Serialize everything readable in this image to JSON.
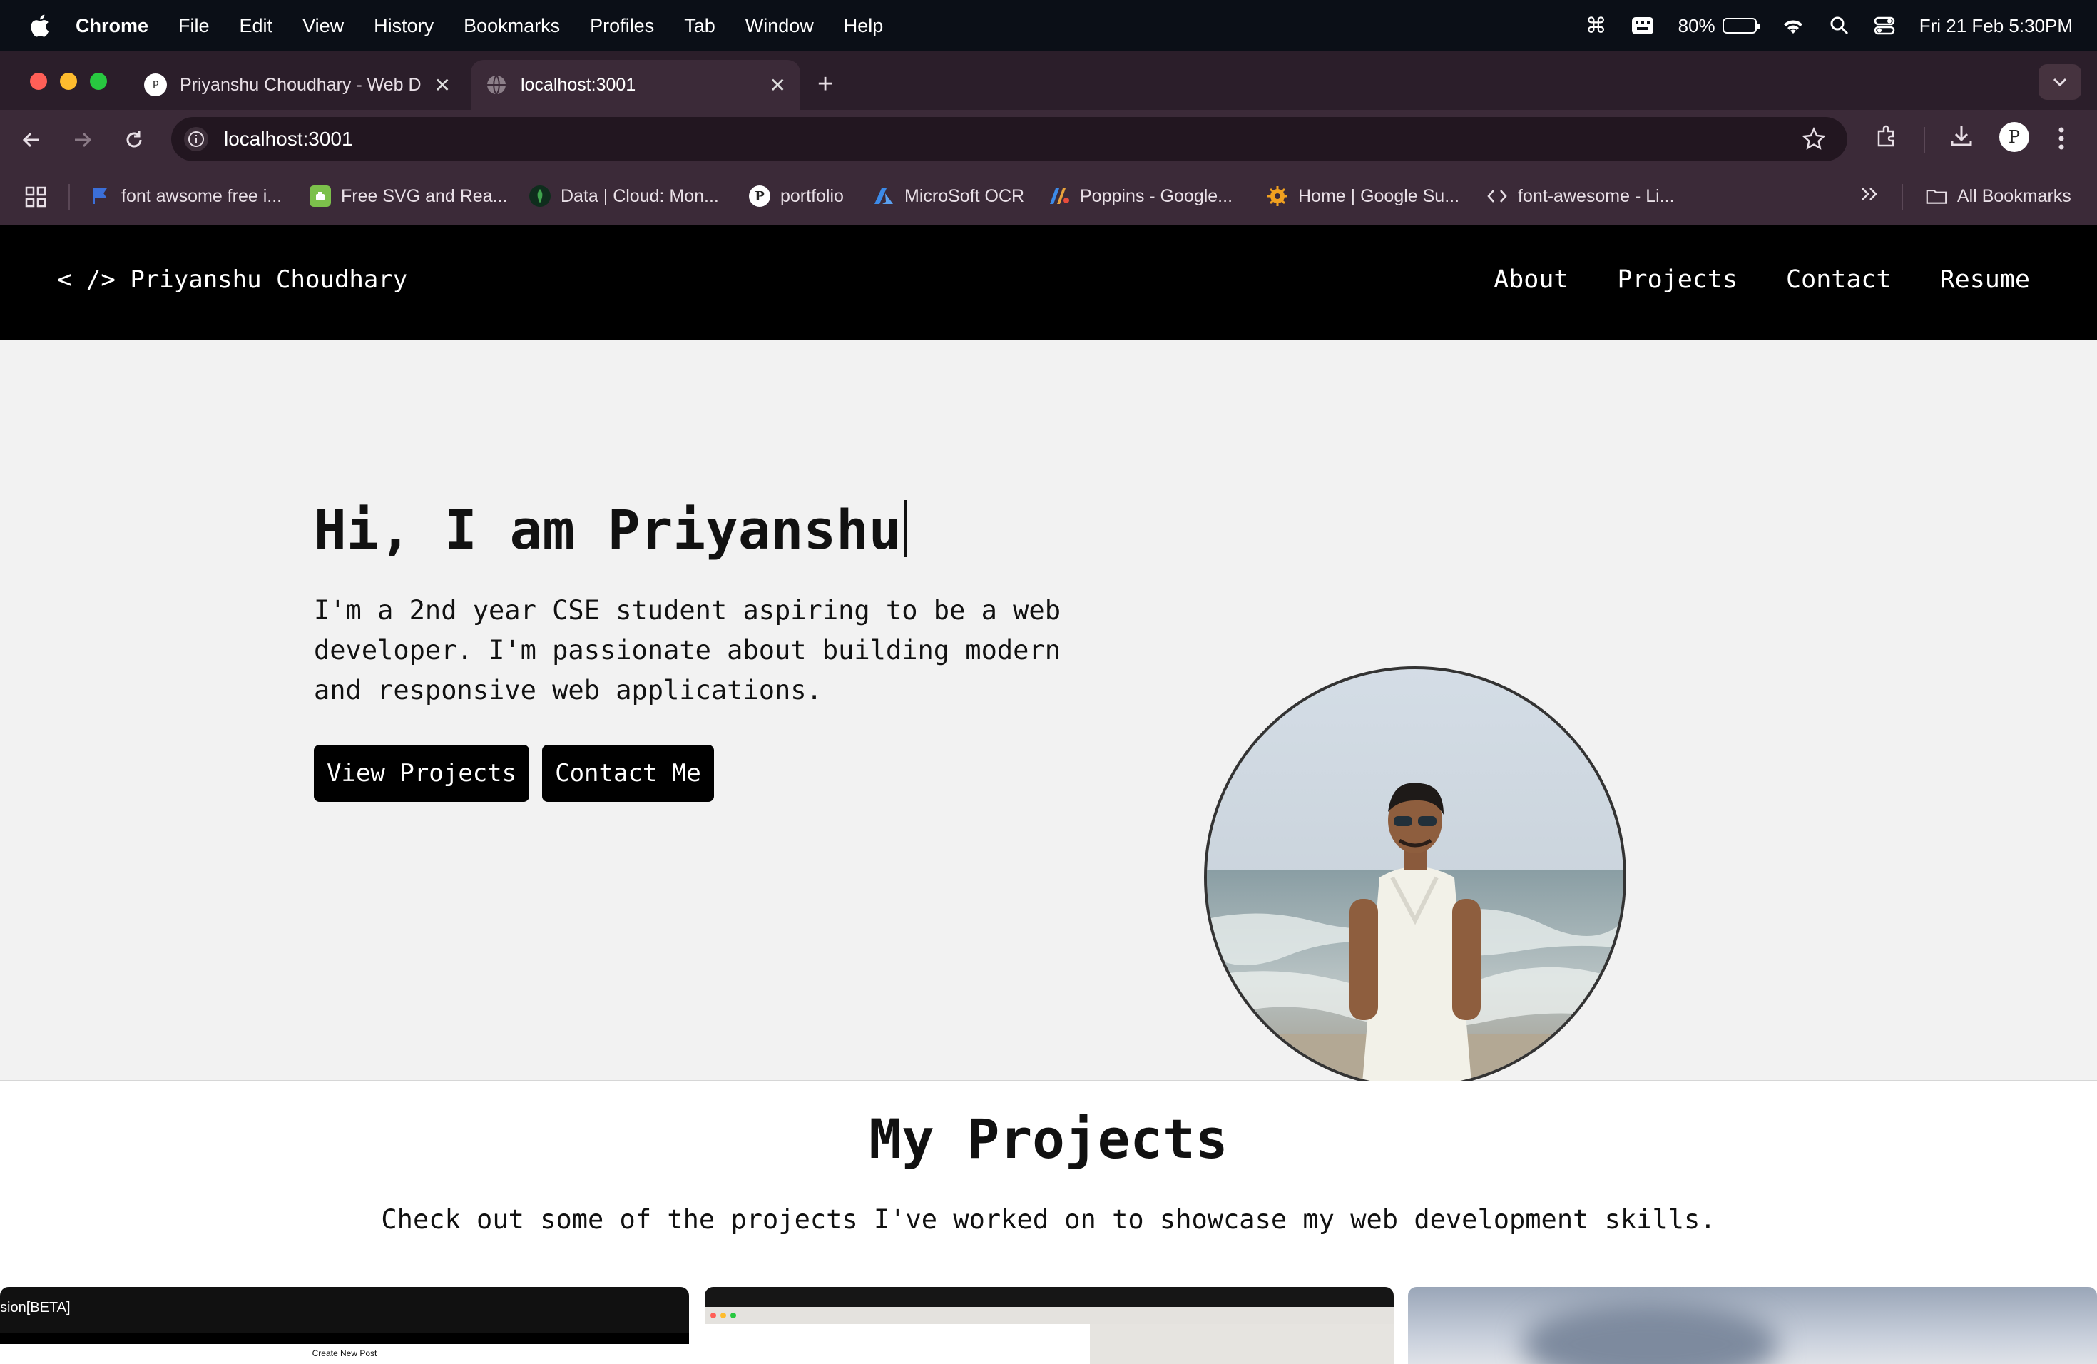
{
  "menubar": {
    "app_name": "Chrome",
    "items": [
      "File",
      "Edit",
      "View",
      "History",
      "Bookmarks",
      "Profiles",
      "Tab",
      "Window",
      "Help"
    ],
    "battery_percent": "80%",
    "battery_level": 0.8,
    "datetime": "Fri 21 Feb  5:30PM"
  },
  "browser": {
    "tabs": [
      {
        "title": "Priyanshu Choudhary - Web D",
        "active": false
      },
      {
        "title": "localhost:3001",
        "active": true
      }
    ],
    "url": "localhost:3001",
    "bookmarks": [
      {
        "label": "font awsome free i...",
        "icon": "flag-icon",
        "color": "#3b6fd8"
      },
      {
        "label": "Free SVG and Rea...",
        "icon": "svg-site-icon",
        "color": "#7cc04b"
      },
      {
        "label": "Data | Cloud: Mon...",
        "icon": "mongodb-leaf-icon",
        "color": "#1f7a3a"
      },
      {
        "label": "portfolio",
        "icon": "portfolio-icon",
        "color": "#ffffff"
      },
      {
        "label": "MicroSoft OCR",
        "icon": "azure-icon",
        "color": "#3c8ae8"
      },
      {
        "label": "Poppins - Google...",
        "icon": "google-fonts-icon",
        "color": "#e8a23c"
      },
      {
        "label": "Home | Google Su...",
        "icon": "google-sites-icon",
        "color": "#f0a020"
      },
      {
        "label": "font-awesome - Li...",
        "icon": "code-icon",
        "color": "#e8dfe6"
      }
    ],
    "all_bookmarks_label": "All Bookmarks"
  },
  "site": {
    "logo": "< /> Priyanshu Choudhary",
    "nav_links": [
      "About",
      "Projects",
      "Contact",
      "Resume"
    ],
    "hero": {
      "title": "Hi, I am Priyanshu",
      "description": "I'm a 2nd year CSE student aspiring to be a web developer. I'm passionate about building modern and responsive web applications.",
      "buttons": [
        "View Projects",
        "Contact Me"
      ]
    },
    "projects": {
      "title": "My Projects",
      "subtitle": "Check out some of the projects I've worked on to showcase my web development skills.",
      "card1_header": "sion[BETA]",
      "card1_body": "Create New Post"
    }
  }
}
